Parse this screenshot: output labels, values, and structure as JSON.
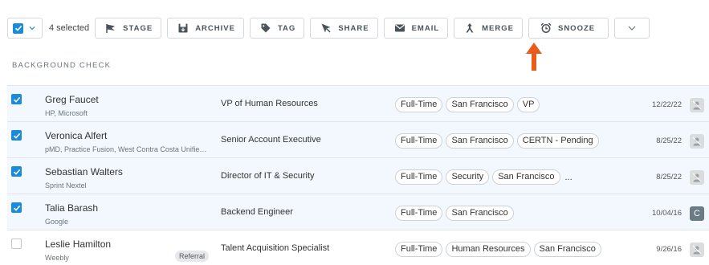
{
  "toolbar": {
    "selected_count": "4 selected",
    "buttons": [
      {
        "label": "STAGE",
        "icon": "flag-icon"
      },
      {
        "label": "ARCHIVE",
        "icon": "archive-icon"
      },
      {
        "label": "TAG",
        "icon": "tag-icon"
      },
      {
        "label": "SHARE",
        "icon": "share-icon"
      },
      {
        "label": "EMAIL",
        "icon": "email-icon"
      },
      {
        "label": "MERGE",
        "icon": "merge-icon"
      },
      {
        "label": "SNOOZE",
        "icon": "alarm-clock-icon"
      }
    ]
  },
  "section": {
    "title": "BACKGROUND CHECK"
  },
  "colors": {
    "accent": "#1a8bd8",
    "arrow": "#e85d1c",
    "selected_row": "#f2f8fd"
  },
  "rows": [
    {
      "selected": true,
      "name": "Greg Faucet",
      "sub": "HP, Microsoft",
      "referral": "",
      "role": "VP of Human Resources",
      "tags": [
        "Full-Time",
        "San Francisco",
        "VP"
      ],
      "more": "",
      "date": "12/22/22",
      "avatar": "person-icon"
    },
    {
      "selected": true,
      "name": "Veronica Alfert",
      "sub": "pMD, Practice Fusion, West Contra Costa Unified ...",
      "referral": "",
      "role": "Senior Account Executive",
      "tags": [
        "Full-Time",
        "San Francisco",
        "CERTN - Pending"
      ],
      "more": "",
      "date": "8/25/22",
      "avatar": "person-icon"
    },
    {
      "selected": true,
      "name": "Sebastian Walters",
      "sub": "Sprint Nextel",
      "referral": "",
      "role": "Director of IT & Security",
      "tags": [
        "Full-Time",
        "Security",
        "San Francisco"
      ],
      "more": "...",
      "date": "8/25/22",
      "avatar": "person-icon"
    },
    {
      "selected": true,
      "name": "Talia Barash",
      "sub": "Google",
      "referral": "",
      "role": "Backend Engineer",
      "tags": [
        "Full-Time",
        "San Francisco"
      ],
      "more": "",
      "date": "10/04/16",
      "avatar": "C"
    },
    {
      "selected": false,
      "name": "Leslie Hamilton",
      "sub": "Weebly",
      "referral": "Referral",
      "role": "Talent Acquisition Specialist",
      "tags": [
        "Full-Time",
        "Human Resources",
        "San Francisco"
      ],
      "more": "",
      "date": "9/26/16",
      "avatar": "person-icon"
    }
  ]
}
